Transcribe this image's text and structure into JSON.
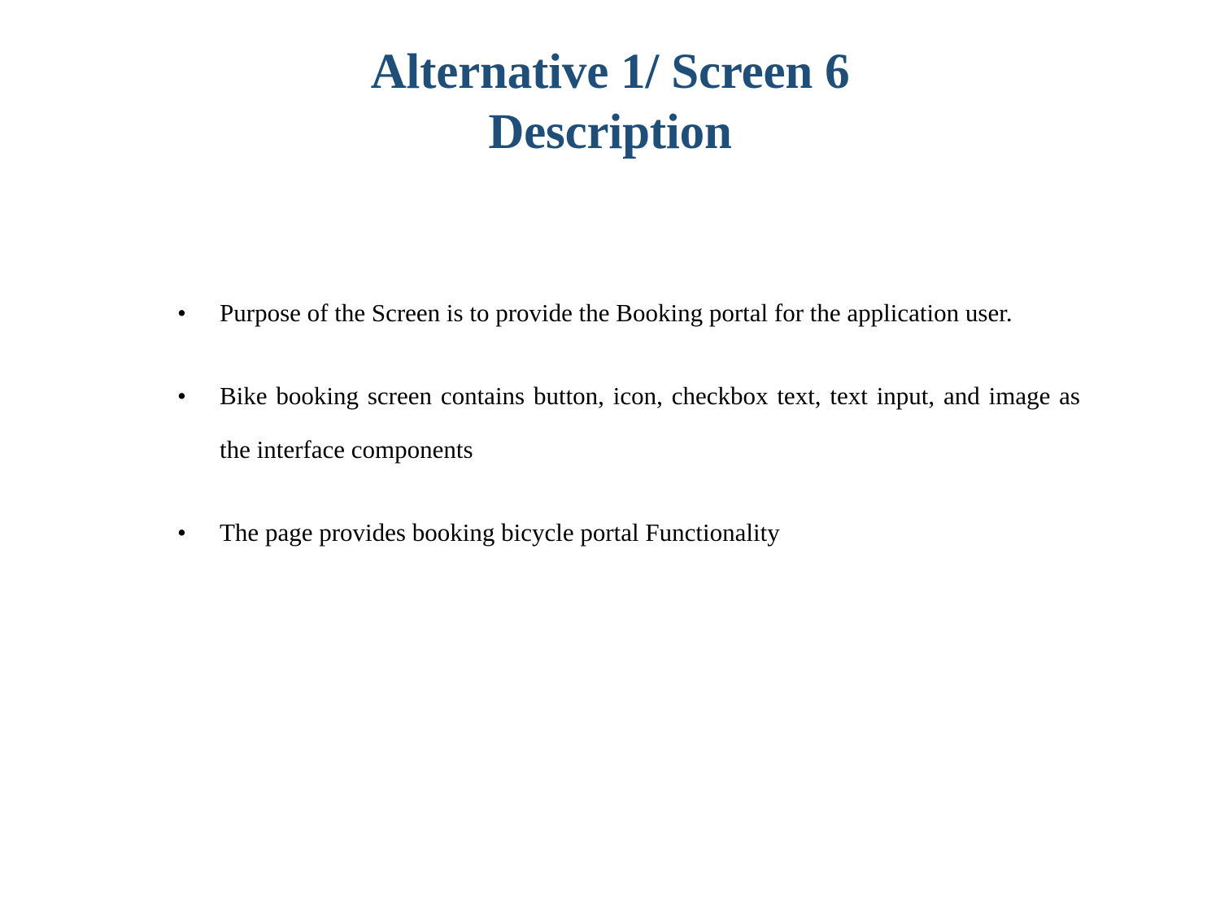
{
  "slide": {
    "background_color": "#ffffff",
    "title": {
      "color": "#1F4E79",
      "lines": [
        "Alternative 1/ Screen 6",
        "Description"
      ]
    },
    "body": {
      "text_color": "#000000",
      "bullet_glyph": "•",
      "bullets": [
        {
          "marker": "•",
          "text": "Purpose of the Screen is to provide the Booking portal for the application user."
        },
        {
          "marker": "•",
          "text": "Bike booking screen contains button, icon, checkbox text, text input, and image as the interface components"
        },
        {
          "marker": "•",
          "text": "The page provides booking bicycle portal Functionality"
        }
      ]
    }
  }
}
